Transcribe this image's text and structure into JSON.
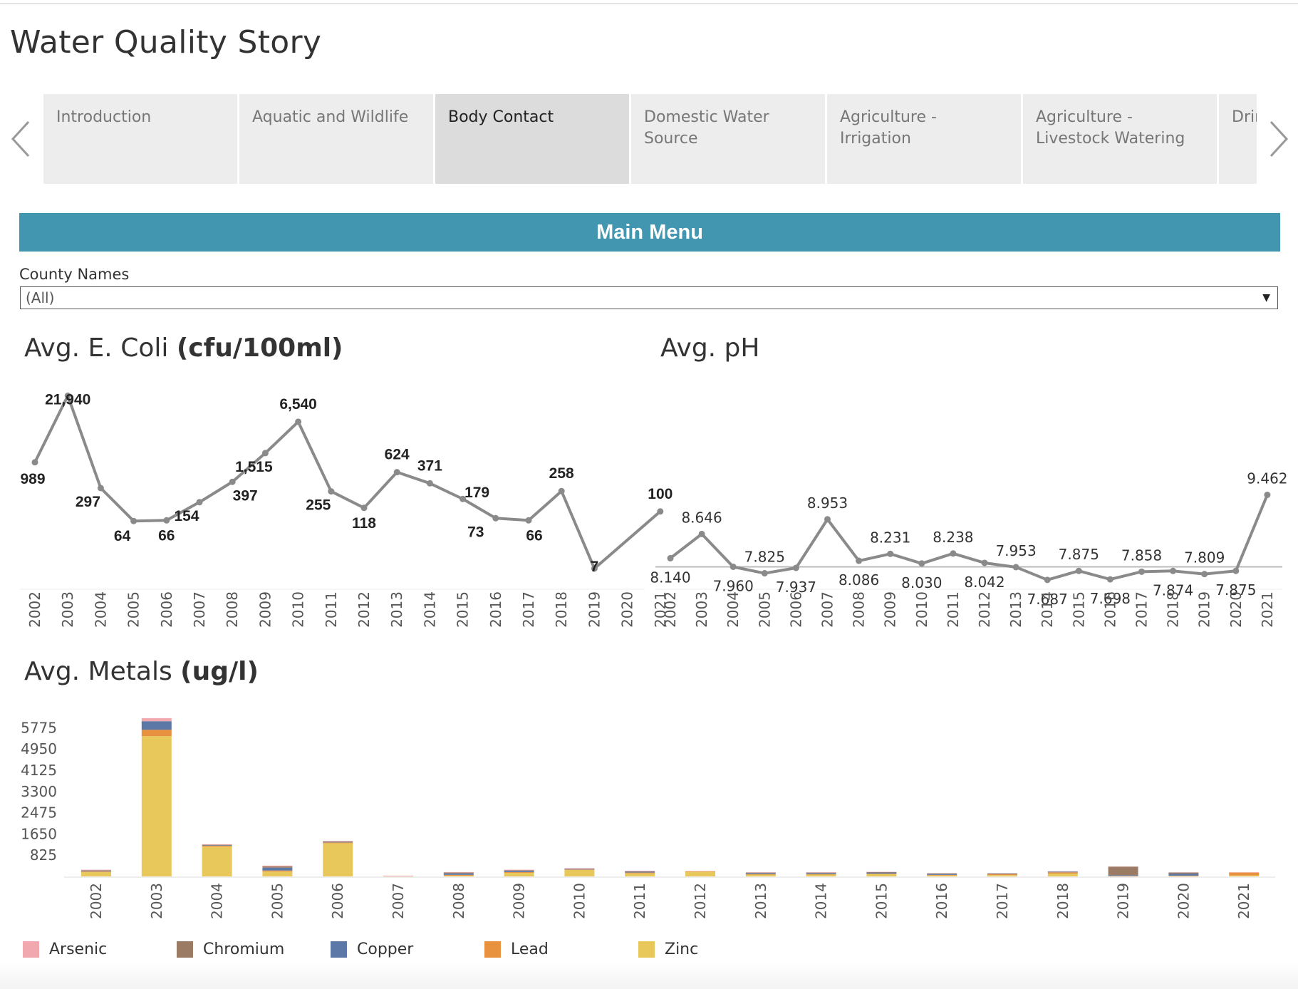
{
  "story": {
    "title": "Water Quality Story"
  },
  "tabs": [
    {
      "label": "Introduction",
      "active": false
    },
    {
      "label": "Aquatic and Wildlife",
      "active": false
    },
    {
      "label": "Body Contact",
      "active": true
    },
    {
      "label": "Domestic Water Source",
      "active": false
    },
    {
      "label": "Agriculture - Irrigation",
      "active": false
    },
    {
      "label": "Agriculture - Livestock Watering",
      "active": false
    },
    {
      "label": "Drinking Park",
      "active": false
    }
  ],
  "main_menu": {
    "label": "Main Menu"
  },
  "filter": {
    "label": "County Names",
    "value": "(All)"
  },
  "panels": {
    "ecoli_title": "Avg. E. Coli",
    "ecoli_unit": "(cfu/100ml)",
    "ph_title": "Avg. pH",
    "metals_title": "Avg. Metals",
    "metals_unit": "(ug/l)"
  },
  "colors": {
    "accent": "#4396b0",
    "line": "#8a8a8a",
    "reference_line": "#bbbbbb",
    "Arsenic": "#f1a8ae",
    "Chromium": "#9c7b65",
    "Copper": "#5b78a6",
    "Lead": "#e8913f",
    "Zinc": "#e8c85b"
  },
  "chart_data": [
    {
      "type": "line",
      "x": [
        "2002",
        "2003",
        "2004",
        "2005",
        "2006",
        "2007",
        "2008",
        "2009",
        "2010",
        "2011",
        "2012",
        "2013",
        "2014",
        "2015",
        "2016",
        "2017",
        "2018",
        "2019",
        "2020",
        "2021"
      ],
      "values": [
        989,
        21940,
        297,
        64,
        66,
        154,
        397,
        1515,
        6540,
        255,
        118,
        624,
        371,
        179,
        73,
        66,
        258,
        7,
        100
      ],
      "labels": [
        "989",
        "21,940",
        "297",
        "64",
        "66",
        "154",
        "397",
        "1,515",
        "6,540",
        "255",
        "118",
        "624",
        "371",
        "179",
        "73",
        "66",
        "258",
        "7",
        "100"
      ],
      "label_years": [
        "2002",
        "2003",
        "2004",
        "2005",
        "2006",
        "2007",
        "2008",
        "2009",
        "2010",
        "2011",
        "2012",
        "2013",
        "2014",
        "2015",
        "2016",
        "2017",
        "2018",
        "2019",
        "2021"
      ],
      "scale": "log"
    },
    {
      "type": "line",
      "x": [
        "2002",
        "2003",
        "2004",
        "2005",
        "2006",
        "2007",
        "2008",
        "2009",
        "2010",
        "2011",
        "2012",
        "2013",
        "2014",
        "2015",
        "2016",
        "2017",
        "2018",
        "2019",
        "2020",
        "2021"
      ],
      "values": [
        8.14,
        8.646,
        7.96,
        7.825,
        7.937,
        8.953,
        8.086,
        8.231,
        8.03,
        8.238,
        8.042,
        7.953,
        7.687,
        7.875,
        7.698,
        7.858,
        7.874,
        7.809,
        7.875,
        9.462
      ],
      "labels": [
        "8.140",
        "8.646",
        "7.960",
        "7.825",
        "7.937",
        "8.953",
        "8.086",
        "8.231",
        "8.030",
        "8.238",
        "8.042",
        "7.953",
        "7.687",
        "7.875",
        "7.698",
        "7.858",
        "7.874",
        "7.809",
        "7.875",
        "9.462"
      ],
      "reference_line": 7.96
    },
    {
      "type": "bar",
      "stacked": true,
      "categories": [
        "2002",
        "2003",
        "2004",
        "2005",
        "2006",
        "2007",
        "2008",
        "2009",
        "2010",
        "2011",
        "2012",
        "2013",
        "2014",
        "2015",
        "2016",
        "2017",
        "2018",
        "2019",
        "2020",
        "2021"
      ],
      "series": [
        {
          "name": "Arsenic",
          "values": [
            20,
            120,
            20,
            30,
            20,
            20,
            20,
            20,
            20,
            20,
            10,
            10,
            10,
            10,
            10,
            10,
            10,
            10,
            10,
            10
          ]
        },
        {
          "name": "Chromium",
          "values": [
            20,
            0,
            20,
            50,
            20,
            0,
            30,
            20,
            10,
            20,
            0,
            20,
            20,
            20,
            20,
            10,
            10,
            330,
            40,
            0
          ]
        },
        {
          "name": "Copper",
          "values": [
            20,
            330,
            20,
            110,
            20,
            0,
            60,
            50,
            20,
            30,
            0,
            40,
            40,
            40,
            40,
            20,
            20,
            30,
            80,
            0
          ]
        },
        {
          "name": "Lead",
          "values": [
            30,
            250,
            30,
            40,
            30,
            10,
            30,
            30,
            20,
            30,
            20,
            20,
            20,
            20,
            20,
            40,
            50,
            20,
            20,
            110
          ]
        },
        {
          "name": "Zinc",
          "values": [
            170,
            5450,
            1160,
            190,
            1290,
            0,
            30,
            140,
            250,
            120,
            180,
            70,
            70,
            90,
            40,
            50,
            110,
            0,
            10,
            40
          ]
        }
      ],
      "ylim": [
        0,
        6400
      ],
      "yticks": [
        "825",
        "1650",
        "2475",
        "3300",
        "4125",
        "4950",
        "5775"
      ],
      "ytick_values": [
        825,
        1650,
        2475,
        3300,
        4125,
        4950,
        5775
      ],
      "legend": [
        "Arsenic",
        "Chromium",
        "Copper",
        "Lead",
        "Zinc"
      ],
      "legend_position": "bottom"
    }
  ]
}
